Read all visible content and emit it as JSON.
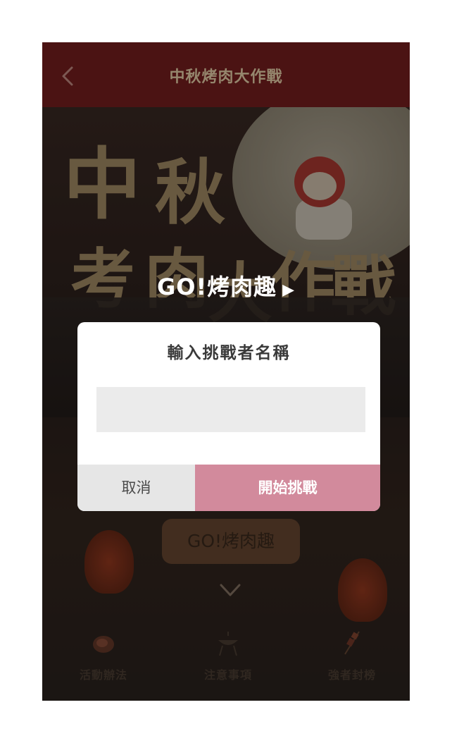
{
  "header": {
    "title": "中秋烤肉大作戰"
  },
  "hero": {
    "caption_text": "GO!烤肉趣",
    "background_glyphs": [
      "中",
      "秋",
      "考",
      "肉",
      "大",
      "作",
      "戰"
    ]
  },
  "dialog": {
    "title": "輸入挑戰者名稱",
    "input_value": "",
    "cancel_label": "取消",
    "start_label": "開始挑戰"
  },
  "main": {
    "go_button_label": "GO!烤肉趣"
  },
  "bottom_nav": {
    "items": [
      {
        "label": "活動辦法",
        "icon": "meat-icon"
      },
      {
        "label": "注意事項",
        "icon": "grill-icon"
      },
      {
        "label": "強者封榜",
        "icon": "skewer-icon"
      }
    ]
  },
  "colors": {
    "header_bg": "#7a1f1f",
    "accent_pink": "#d28a9c",
    "cancel_gray": "#e6e6e6"
  }
}
